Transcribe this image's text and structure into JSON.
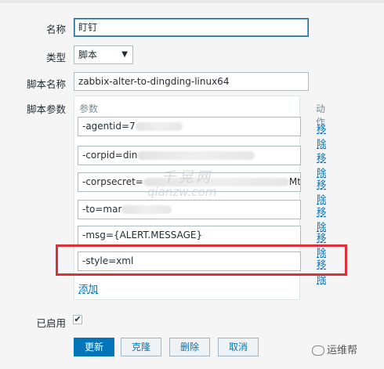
{
  "form": {
    "name_label": "名称",
    "name_value": "盯钉",
    "type_label": "类型",
    "type_value": "脚本",
    "script_name_label": "脚本名称",
    "script_name_value": "zabbix-alter-to-dingding-linux64",
    "script_params_label": "脚本参数",
    "enabled_label": "已启用"
  },
  "params": {
    "col_param": "参数",
    "col_action": "动作",
    "remove_label": "移除",
    "add_label": "添加",
    "rows": [
      {
        "text_a": "-agentid=7",
        "text_b": ""
      },
      {
        "text_a": "-corpid=din",
        "text_b": ""
      },
      {
        "text_a": "-corpsecret=",
        "text_b": "Mtphy"
      },
      {
        "text_a": "-to=mar",
        "text_b": ""
      },
      {
        "text_a": "-msg={ALERT.MESSAGE}",
        "text_b": ""
      },
      {
        "text_a": "-style=xml",
        "text_b": ""
      }
    ]
  },
  "buttons": {
    "update": "更新",
    "clone": "克隆",
    "delete": "删除",
    "cancel": "取消"
  },
  "watermark": {
    "cn": "千晃网",
    "domain": "qianzw.com",
    "wechat": "运维帮"
  }
}
